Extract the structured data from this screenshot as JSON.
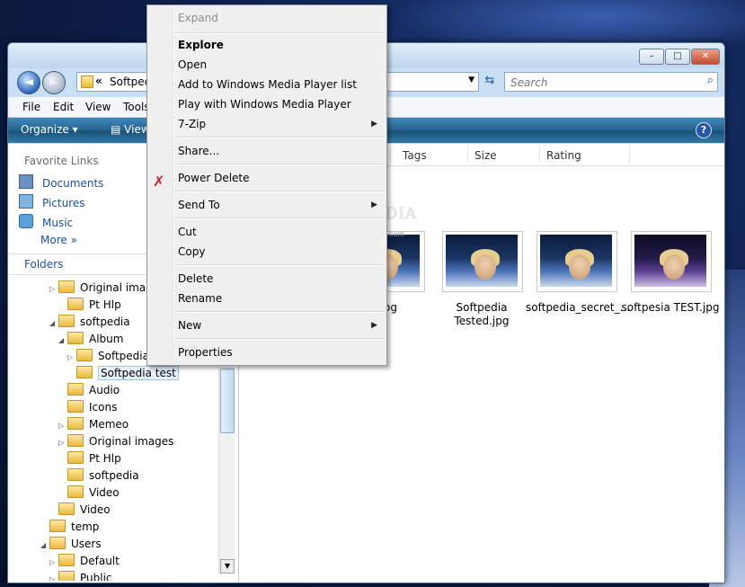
{
  "window": {
    "caption_buttons": [
      "–",
      "□",
      "✕"
    ]
  },
  "address": {
    "chevron": "«",
    "path": "Softpec",
    "dropdown": "▼",
    "refresh": "⇆",
    "search_placeholder": "Search",
    "search_icon": "⌕"
  },
  "nav": {
    "back": "◄",
    "forward": "►"
  },
  "menubar": [
    "File",
    "Edit",
    "View",
    "Tools"
  ],
  "cmdbar": {
    "organize": "Organize ▾",
    "views": "▤ Views",
    "help": "?"
  },
  "navpane": {
    "favorites_header": "Favorite Links",
    "favorites": [
      "Documents",
      "Pictures",
      "Music",
      "More  »"
    ],
    "folders_header": "Folders",
    "tree": [
      {
        "label": "Original images",
        "arrow": "▷"
      },
      {
        "label": "Pt Hlp",
        "arrow": ""
      },
      {
        "label": "softpedia",
        "arrow": "◢"
      },
      {
        "label": "Album",
        "arrow": "◢"
      },
      {
        "label": "Softpedia",
        "arrow": "▷"
      },
      {
        "label": "Softpedia test",
        "arrow": ""
      },
      {
        "label": "Audio",
        "arrow": ""
      },
      {
        "label": "Icons",
        "arrow": ""
      },
      {
        "label": "Memeo",
        "arrow": "▷"
      },
      {
        "label": "Original images",
        "arrow": "▷"
      },
      {
        "label": "Pt Hlp",
        "arrow": ""
      },
      {
        "label": "softpedia",
        "arrow": ""
      },
      {
        "label": "Video",
        "arrow": ""
      },
      {
        "label": "Video",
        "arrow": ""
      },
      {
        "label": "temp",
        "arrow": ""
      },
      {
        "label": "Users",
        "arrow": "◢"
      },
      {
        "label": "Default",
        "arrow": "▷"
      },
      {
        "label": "Public",
        "arrow": "▷"
      }
    ]
  },
  "columns": [
    "Tags",
    "Size",
    "Rating"
  ],
  "files": [
    {
      "name": "Test.jpg"
    },
    {
      "name": "Softpedia Tested.jpg"
    },
    {
      "name": "softpedia_secret_..."
    },
    {
      "name": "softpesia TEST.jpg"
    }
  ],
  "watermark": {
    "text": "SOFTPEDIA",
    "url": "www.softpedia.com"
  },
  "context_menu": {
    "items": [
      {
        "label": "Expand",
        "disabled": true
      },
      {
        "label": "Explore",
        "bold": true
      },
      {
        "label": "Open"
      },
      {
        "label": "Add to Windows Media Player list"
      },
      {
        "label": "Play with Windows Media Player"
      },
      {
        "label": "7-Zip",
        "submenu": true
      },
      {
        "label": "Share..."
      },
      {
        "label": "Power Delete",
        "icon": "power-delete-icon"
      },
      {
        "label": "Send To",
        "submenu": true
      },
      {
        "label": "Cut"
      },
      {
        "label": "Copy"
      },
      {
        "label": "Delete"
      },
      {
        "label": "Rename"
      },
      {
        "label": "New",
        "submenu": true
      },
      {
        "label": "Properties"
      }
    ],
    "submenu_arrow": "▶",
    "power_delete_glyph": "✗"
  },
  "colors": {
    "accent": "#1d4fa5",
    "cmdbar": "#27628f"
  }
}
